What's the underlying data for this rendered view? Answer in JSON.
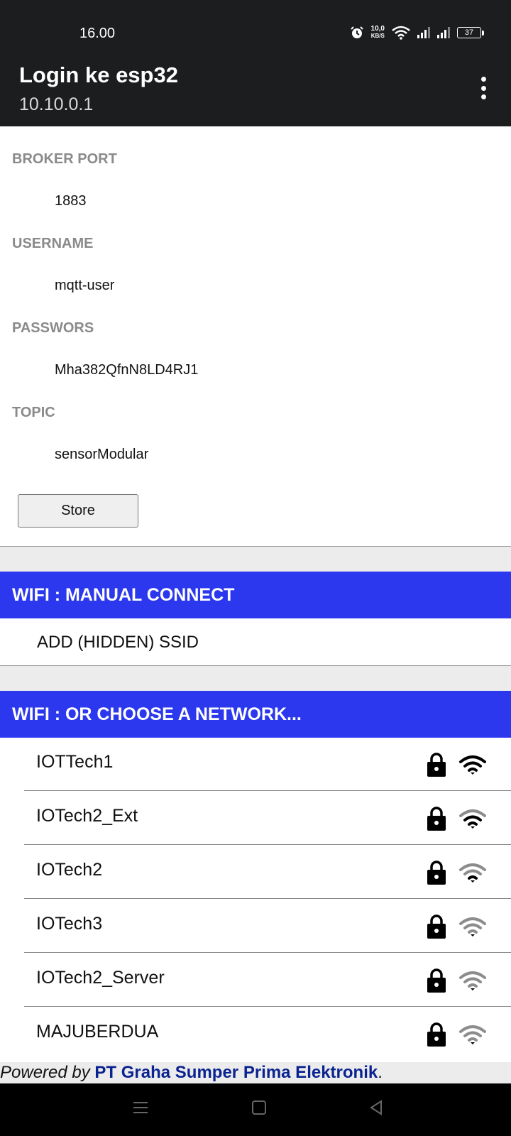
{
  "status_bar": {
    "time": "16.00",
    "net_speed_value": "10,0",
    "net_speed_unit": "KB/S",
    "battery": "37",
    "icons": [
      "alarm-icon",
      "wifi-icon",
      "signal-icon",
      "signal-icon",
      "battery-icon"
    ]
  },
  "app_bar": {
    "title": "Login ke esp32",
    "subtitle": "10.10.0.1",
    "menu_icon": "more-vert-icon"
  },
  "form": {
    "broker_port_label": "BROKER PORT",
    "broker_port_value": "1883",
    "username_label": "USERNAME",
    "username_value": "mqtt-user",
    "password_label": "PASSWORS",
    "password_value": "Mha382QfnN8LD4RJ1",
    "topic_label": "TOPIC",
    "topic_value": "sensorModular",
    "store_label": "Store"
  },
  "manual": {
    "header": "WIFI : MANUAL CONNECT",
    "add_ssid": "ADD (HIDDEN) SSID"
  },
  "networks": {
    "header": "WIFI : OR CHOOSE A NETWORK...",
    "items": [
      {
        "ssid": "IOTTech1",
        "locked": true,
        "signal": 4
      },
      {
        "ssid": "IOTech2_Ext",
        "locked": true,
        "signal": 3
      },
      {
        "ssid": "IOTech2",
        "locked": true,
        "signal": 2
      },
      {
        "ssid": "IOTech3",
        "locked": true,
        "signal": 1
      },
      {
        "ssid": "IOTech2_Server",
        "locked": true,
        "signal": 1
      },
      {
        "ssid": "MAJUBERDUA",
        "locked": true,
        "signal": 1
      }
    ]
  },
  "footer": {
    "prefix": "Powered by",
    "company": "PT Graha Sumper Prima Elektronik",
    "suffix": "."
  },
  "colors": {
    "header_blue": "#2b38ee",
    "link_blue": "#0b2390",
    "label_gray": "#8a8a8a",
    "appbar": "#1b1d1f"
  }
}
